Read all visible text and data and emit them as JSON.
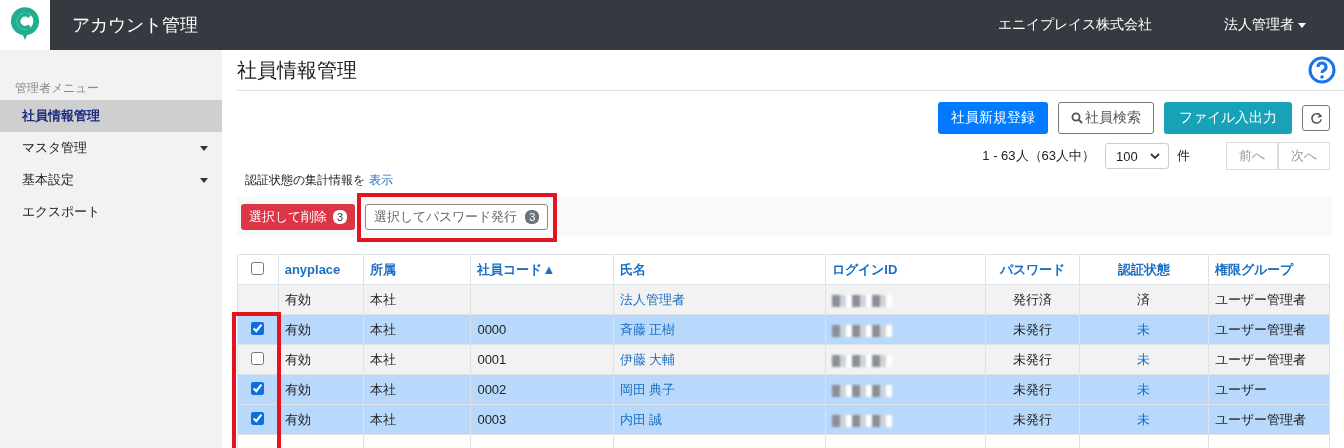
{
  "header": {
    "app_title": "アカウント管理",
    "company": "エニイプレイス株式会社",
    "user_menu": "法人管理者"
  },
  "sidebar": {
    "section_label": "管理者メニュー",
    "items": [
      {
        "label": "社員情報管理",
        "selected": true,
        "has_submenu": false
      },
      {
        "label": "マスタ管理",
        "selected": false,
        "has_submenu": true
      },
      {
        "label": "基本設定",
        "selected": false,
        "has_submenu": true
      },
      {
        "label": "エクスポート",
        "selected": false,
        "has_submenu": false
      }
    ]
  },
  "page": {
    "title": "社員情報管理",
    "actions": [
      {
        "label": "社員新規登録",
        "kind": "primary"
      },
      {
        "label": "社員検索",
        "kind": "search"
      },
      {
        "label": "ファイル入出力",
        "kind": "info"
      }
    ],
    "range_text": "1 - 63人（63人中）",
    "page_size": "100",
    "page_size_unit": "件",
    "prev": "前へ",
    "next": "次へ",
    "summary_text": "認証状態の集計情報を",
    "summary_link": "表示",
    "bulk_delete": {
      "label": "選択して削除",
      "count": "3"
    },
    "bulk_password": {
      "label": "選択してパスワード発行",
      "count": "3"
    }
  },
  "table": {
    "all_checked": false,
    "columns": [
      {
        "label": "anyplace"
      },
      {
        "label": "所属"
      },
      {
        "label": "社員コード▲"
      },
      {
        "label": "氏名"
      },
      {
        "label": "ログインID"
      },
      {
        "label": "パスワード"
      },
      {
        "label": "認証状態"
      },
      {
        "label": "権限グループ"
      }
    ],
    "rows": [
      {
        "kind": "fixed",
        "checked": false,
        "anyplace": "有効",
        "dept": "本社",
        "code": "",
        "name": "法人管理者",
        "password": "発行済",
        "auth": "済",
        "auth_link": false,
        "group": "ユーザー管理者"
      },
      {
        "kind": "selectable",
        "checked": true,
        "anyplace": "有効",
        "dept": "本社",
        "code": "0000",
        "name": "斉藤 正樹",
        "password": "未発行",
        "auth": "未",
        "auth_link": true,
        "group": "ユーザー管理者"
      },
      {
        "kind": "selectable",
        "checked": false,
        "anyplace": "有効",
        "dept": "本社",
        "code": "0001",
        "name": "伊藤 大輔",
        "password": "未発行",
        "auth": "未",
        "auth_link": true,
        "group": "ユーザー管理者"
      },
      {
        "kind": "selectable",
        "checked": true,
        "anyplace": "有効",
        "dept": "本社",
        "code": "0002",
        "name": "岡田 典子",
        "password": "未発行",
        "auth": "未",
        "auth_link": true,
        "group": "ユーザー"
      },
      {
        "kind": "selectable",
        "checked": true,
        "anyplace": "有効",
        "dept": "本社",
        "code": "0003",
        "name": "内田 誠",
        "password": "未発行",
        "auth": "未",
        "auth_link": true,
        "group": "ユーザー管理者"
      }
    ]
  }
}
